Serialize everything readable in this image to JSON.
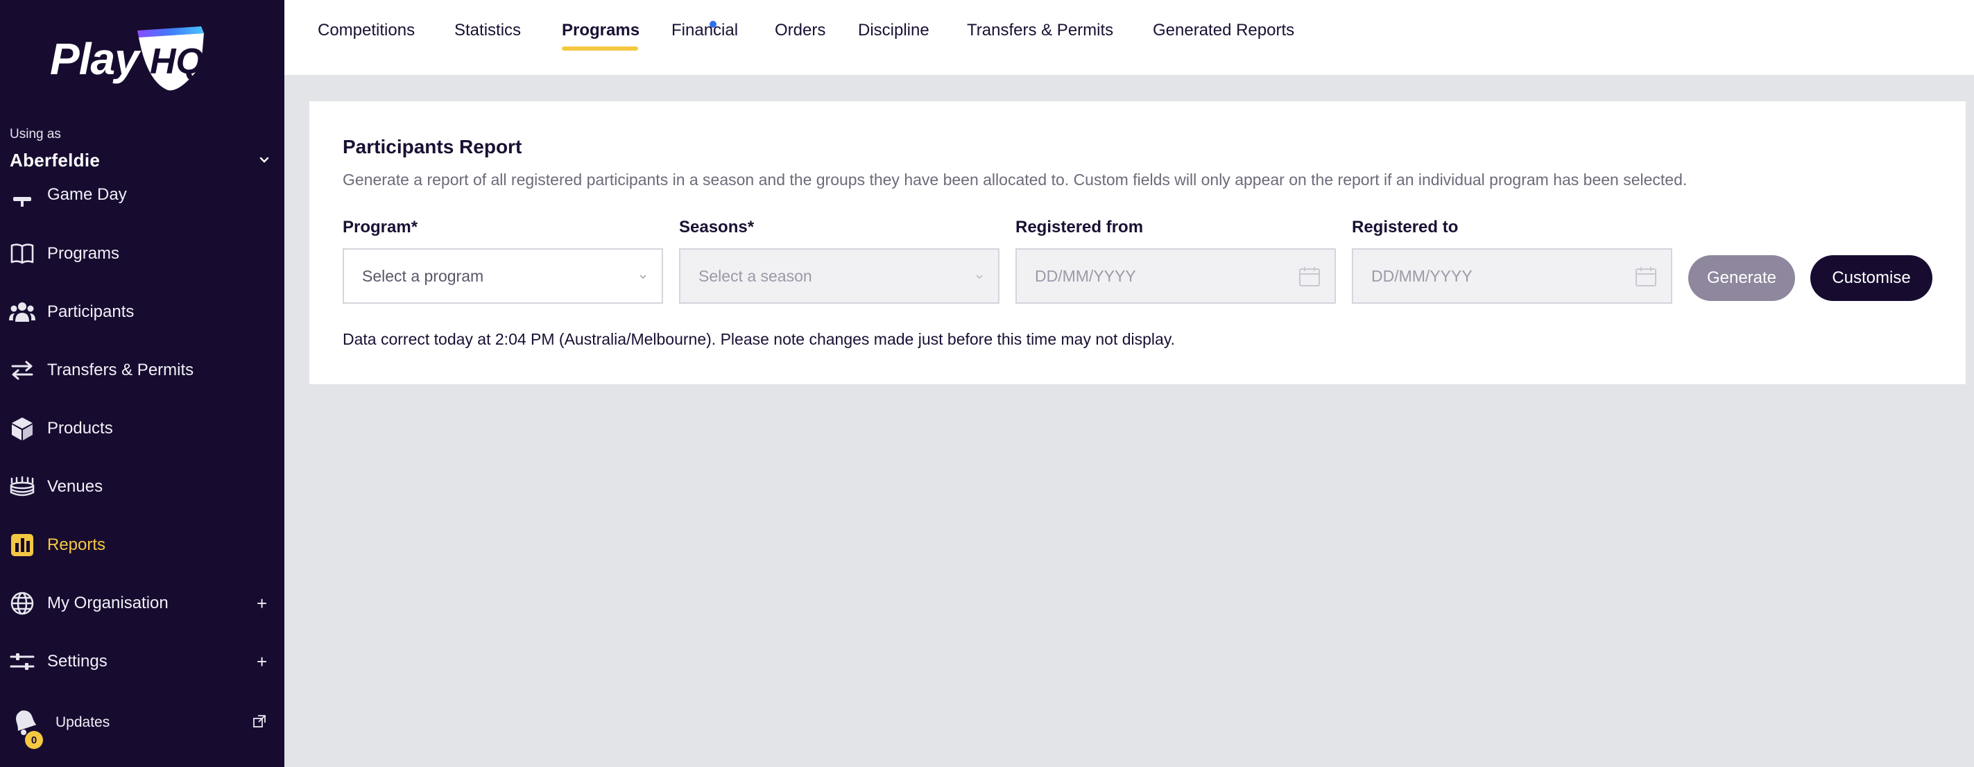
{
  "brand": {
    "logo_text": "Play",
    "logo_mark": "HQ"
  },
  "sidebar": {
    "using_as_label": "Using as",
    "org_name": "Aberfeldie",
    "items": [
      {
        "label": "Game Day",
        "icon": "whistle-icon"
      },
      {
        "label": "Programs",
        "icon": "book-icon"
      },
      {
        "label": "Participants",
        "icon": "people-icon"
      },
      {
        "label": "Transfers & Permits",
        "icon": "transfer-arrows-icon"
      },
      {
        "label": "Products",
        "icon": "box-icon"
      },
      {
        "label": "Venues",
        "icon": "stadium-icon"
      },
      {
        "label": "Reports",
        "icon": "bar-chart-icon",
        "active": true
      },
      {
        "label": "My Organisation",
        "icon": "globe-icon",
        "expand": "+"
      },
      {
        "label": "Settings",
        "icon": "sliders-icon",
        "expand": "+"
      }
    ],
    "updates": {
      "label": "Updates",
      "badge": "0",
      "icon": "bell-icon"
    }
  },
  "tabs": [
    {
      "label": "Competitions",
      "has_dot": true
    },
    {
      "label": "Statistics"
    },
    {
      "label": "Programs",
      "active": true
    },
    {
      "label": "Financial"
    },
    {
      "label": "Orders"
    },
    {
      "label": "Discipline"
    },
    {
      "label": "Transfers & Permits"
    },
    {
      "label": "Generated Reports"
    }
  ],
  "report": {
    "title": "Participants Report",
    "description": "Generate a report of all registered participants in a season and the groups they have been allocated to. Custom fields will only appear on the report if an individual program has been selected.",
    "fields": {
      "program": {
        "label": "Program*",
        "placeholder": "Select a program"
      },
      "seasons": {
        "label": "Seasons*",
        "placeholder": "Select a season"
      },
      "from": {
        "label": "Registered from",
        "placeholder": "DD/MM/YYYY"
      },
      "to": {
        "label": "Registered to",
        "placeholder": "DD/MM/YYYY"
      }
    },
    "generate_label": "Generate",
    "customise_label": "Customise",
    "note": "Data correct today at 2:04 PM (Australia/Melbourne). Please note changes made just before this time may not display."
  },
  "colors": {
    "sidebar_bg": "#170c30",
    "accent": "#f5c842",
    "tab_dot": "#2f6ff2",
    "generate_disabled": "#8e879d"
  }
}
